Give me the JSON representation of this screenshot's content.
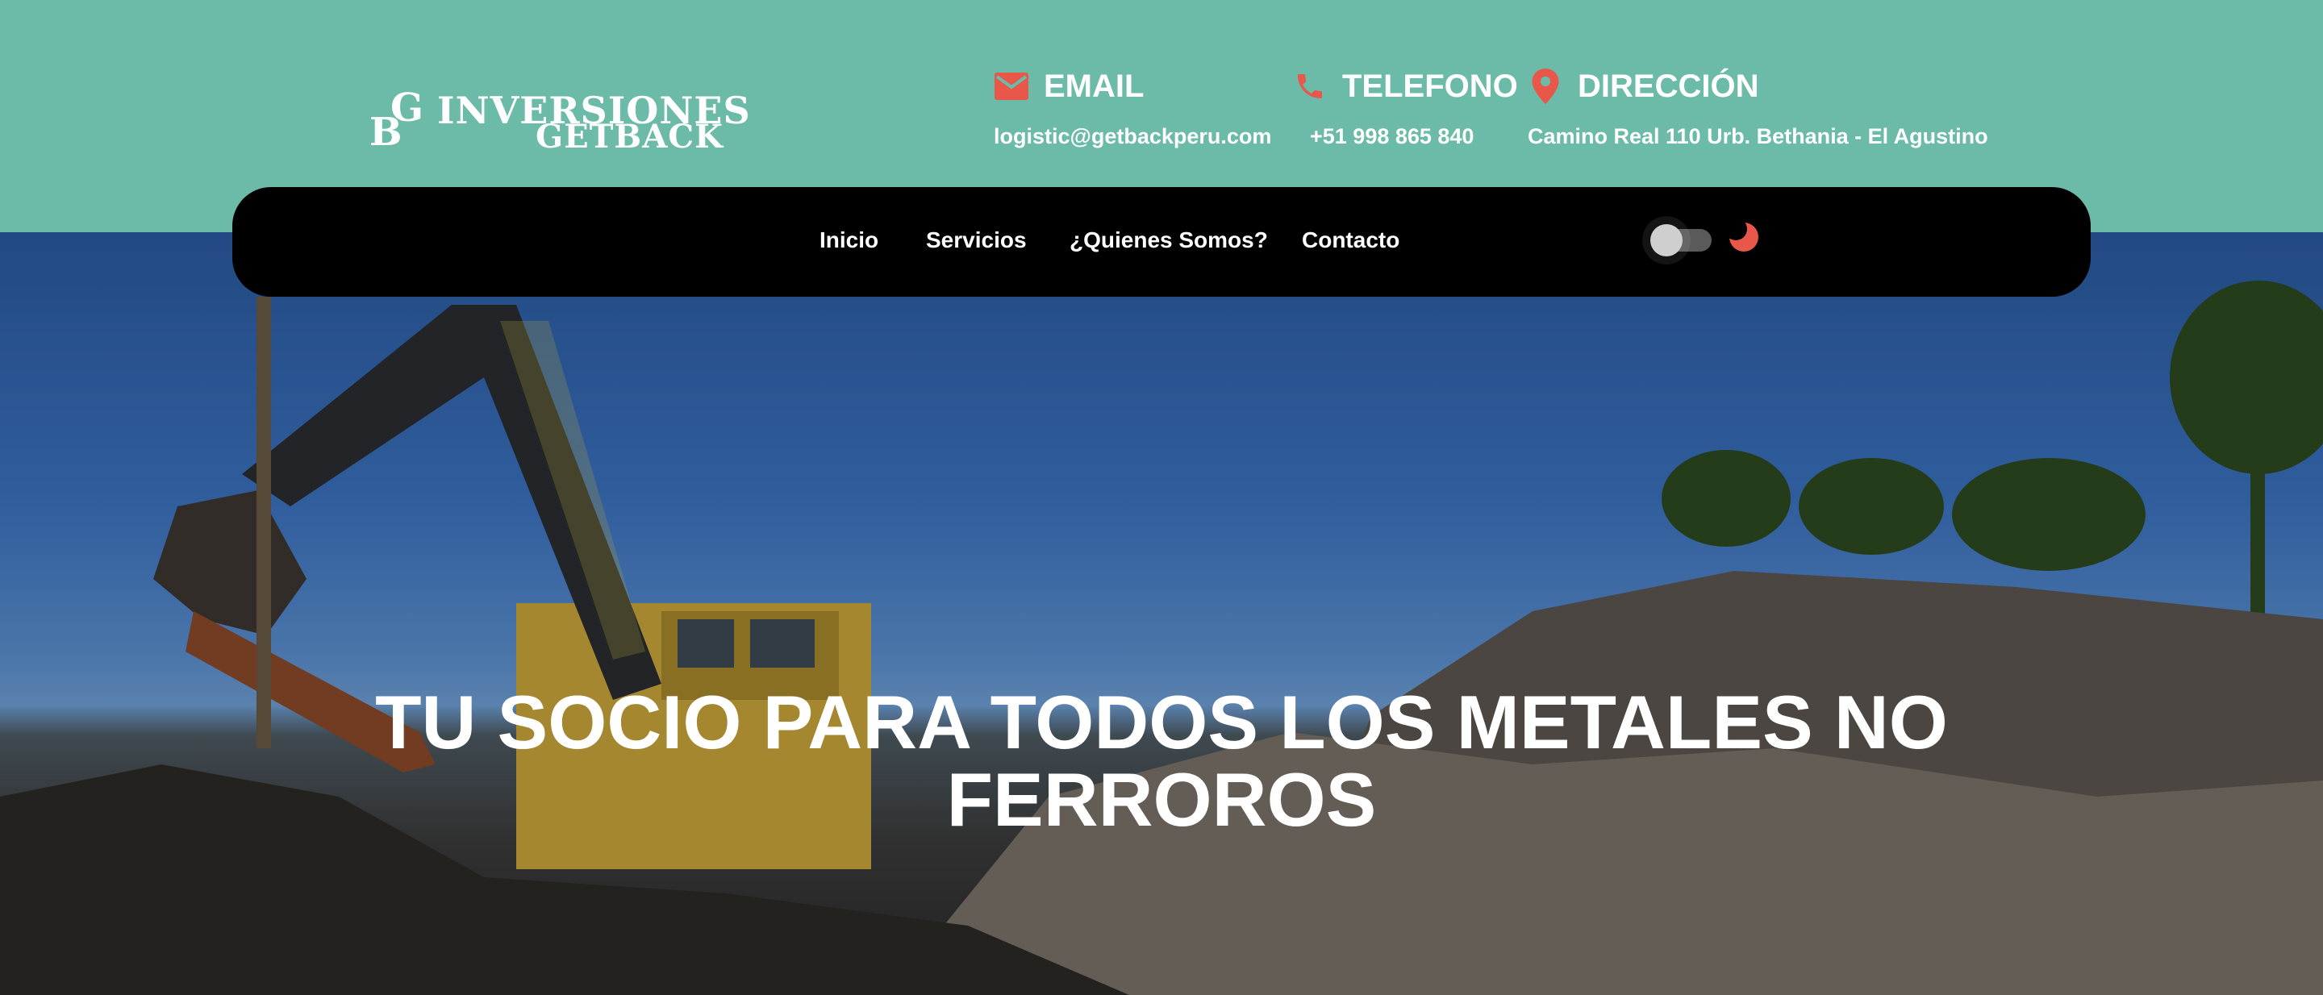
{
  "logo": {
    "letter_b": "B",
    "letter_g": "G",
    "line1": "INVERSIONES",
    "line2": "GETBACK"
  },
  "contacts": [
    {
      "icon": "email-icon",
      "title": "EMAIL",
      "value": "logistic@getbackperu.com"
    },
    {
      "icon": "phone-icon",
      "title": "TELEFONO",
      "value": "+51 998 865 840"
    },
    {
      "icon": "location-pin-icon",
      "title": "DIRECCIÓN",
      "value": "Camino Real 110 Urb. Bethania - El Agustino"
    }
  ],
  "nav": {
    "items": [
      "Inicio",
      "Servicios",
      "¿Quienes Somos?",
      "Contacto"
    ],
    "theme_toggle": "off"
  },
  "hero": {
    "title": "TU SOCIO PARA TODOS LOS METALES NO FERROROS"
  },
  "colors": {
    "topbar": "#6bbba8",
    "accent": "#e8574a",
    "nav_bg": "#000000"
  }
}
